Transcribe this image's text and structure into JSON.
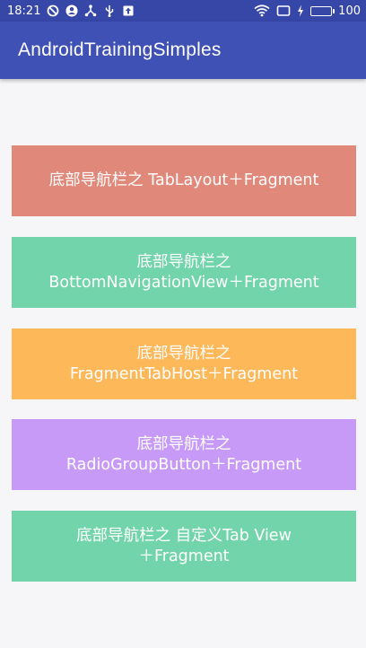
{
  "status_bar": {
    "time": "18:21",
    "battery_level": "100",
    "battery_fraction": 1.0,
    "left_icons": [
      "do-not-disturb-icon",
      "account-icon",
      "share-network-icon",
      "usb-icon",
      "upload-icon"
    ],
    "right_icons": [
      "wifi-icon",
      "screen-cast-icon",
      "charging-bolt-icon",
      "battery-icon"
    ]
  },
  "app_bar": {
    "title": "AndroidTrainingSimples",
    "color": "#3f51b5"
  },
  "buttons": [
    {
      "label": "底部导航栏之 TabLayout＋Fragment",
      "color": "#e0887a"
    },
    {
      "label": "底部导航栏之\nBottomNavigationView＋Fragment",
      "color": "#72d4ab"
    },
    {
      "label": "底部导航栏之\nFragmentTabHost＋Fragment",
      "color": "#fdb85a"
    },
    {
      "label": "底部导航栏之\nRadioGroupButton＋Fragment",
      "color": "#c79af7"
    },
    {
      "label": "底部导航栏之  自定义Tab View\n＋Fragment",
      "color": "#72d4ab"
    }
  ]
}
